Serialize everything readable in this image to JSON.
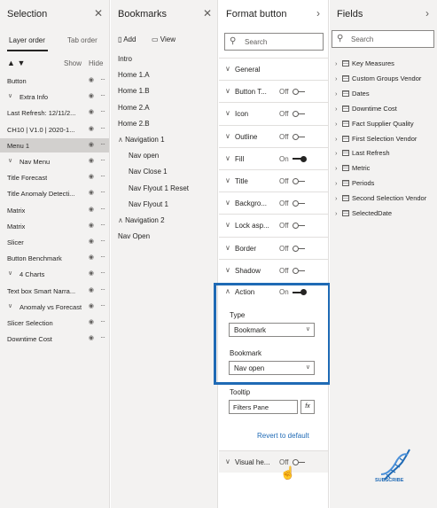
{
  "selection": {
    "title": "Selection",
    "tabs": [
      "Layer order",
      "Tab order"
    ],
    "show_label": "Show",
    "hide_label": "Hide",
    "items": [
      {
        "label": "Button",
        "indent": 0,
        "group": false,
        "selected": false
      },
      {
        "label": "Extra Info",
        "indent": 0,
        "group": true,
        "selected": false
      },
      {
        "label": "Last Refresh: 12/11/2...",
        "indent": 1,
        "group": false,
        "selected": false
      },
      {
        "label": "CH10 | V1.0 | 2020-1...",
        "indent": 1,
        "group": false,
        "selected": false
      },
      {
        "label": "Menu 1",
        "indent": 0,
        "group": false,
        "selected": true
      },
      {
        "label": "Nav Menu",
        "indent": 0,
        "group": true,
        "selected": false
      },
      {
        "label": "Title Forecast",
        "indent": 0,
        "group": false,
        "selected": false
      },
      {
        "label": "Title Anomaly Detecti...",
        "indent": 0,
        "group": false,
        "selected": false
      },
      {
        "label": "Matrix",
        "indent": 0,
        "group": false,
        "selected": false
      },
      {
        "label": "Matrix",
        "indent": 0,
        "group": false,
        "selected": false
      },
      {
        "label": "Slicer",
        "indent": 0,
        "group": false,
        "selected": false
      },
      {
        "label": "Button Benchmark",
        "indent": 0,
        "group": false,
        "selected": false
      },
      {
        "label": "4 Charts",
        "indent": 0,
        "group": true,
        "selected": false
      },
      {
        "label": "Text box Smart Narra...",
        "indent": 0,
        "group": false,
        "selected": false
      },
      {
        "label": "Anomaly vs Forecast",
        "indent": 0,
        "group": true,
        "selected": false
      },
      {
        "label": "Slicer Selection",
        "indent": 0,
        "group": false,
        "selected": false
      },
      {
        "label": "Downtime Cost",
        "indent": 0,
        "group": false,
        "selected": false
      }
    ]
  },
  "bookmarks": {
    "title": "Bookmarks",
    "add_label": "Add",
    "view_label": "View",
    "items": [
      {
        "label": "Intro",
        "indent": 0,
        "group": false
      },
      {
        "label": "Home 1.A",
        "indent": 0,
        "group": false
      },
      {
        "label": "Home 1.B",
        "indent": 0,
        "group": false
      },
      {
        "label": "Home 2.A",
        "indent": 0,
        "group": false
      },
      {
        "label": "Home 2.B",
        "indent": 0,
        "group": false
      },
      {
        "label": "Navigation 1",
        "indent": 0,
        "group": true
      },
      {
        "label": "Nav open",
        "indent": 1,
        "group": false
      },
      {
        "label": "Nav Close 1",
        "indent": 1,
        "group": false
      },
      {
        "label": "Nav Flyout 1 Reset",
        "indent": 1,
        "group": false
      },
      {
        "label": "Nav Flyout 1",
        "indent": 1,
        "group": false
      },
      {
        "label": "Navigation 2",
        "indent": 0,
        "group": true
      },
      {
        "label": "Nav Open",
        "indent": 0,
        "group": false
      }
    ]
  },
  "format": {
    "title": "Format button",
    "search_placeholder": "Search",
    "rows": [
      {
        "label": "General",
        "state": "",
        "on": null
      },
      {
        "label": "Button T...",
        "state": "Off",
        "on": false
      },
      {
        "label": "Icon",
        "state": "Off",
        "on": false
      },
      {
        "label": "Outline",
        "state": "Off",
        "on": false
      },
      {
        "label": "Fill",
        "state": "On",
        "on": true
      },
      {
        "label": "Title",
        "state": "Off",
        "on": false
      },
      {
        "label": "Backgro...",
        "state": "Off",
        "on": false
      },
      {
        "label": "Lock asp...",
        "state": "Off",
        "on": false
      },
      {
        "label": "Border",
        "state": "Off",
        "on": false
      },
      {
        "label": "Shadow",
        "state": "Off",
        "on": false
      }
    ],
    "action": {
      "label": "Action",
      "state": "On",
      "on": true
    },
    "type_label": "Type",
    "type_value": "Bookmark",
    "bookmark_label": "Bookmark",
    "bookmark_value": "Nav open",
    "tooltip_label": "Tooltip",
    "tooltip_value": "Filters Pane",
    "fx_label": "fx",
    "revert_label": "Revert to default",
    "visual_header": {
      "label": "Visual he...",
      "state": "Off",
      "on": false
    }
  },
  "fields": {
    "title": "Fields",
    "search_placeholder": "Search",
    "items": [
      "Key Measures",
      "Custom Groups Vendor",
      "Dates",
      "Downtime Cost",
      "Fact Supplier Quality",
      "First Selection Vendor",
      "Last Refresh",
      "Metric",
      "Periods",
      "Second Selection Vendor",
      "SelectedDate"
    ]
  },
  "logo_text": "SUBSCRIBE",
  "colors": {
    "accent": "#1f6ab5",
    "selected_row": "#d2d0ce",
    "pane_bg": "#f3f2f1"
  }
}
